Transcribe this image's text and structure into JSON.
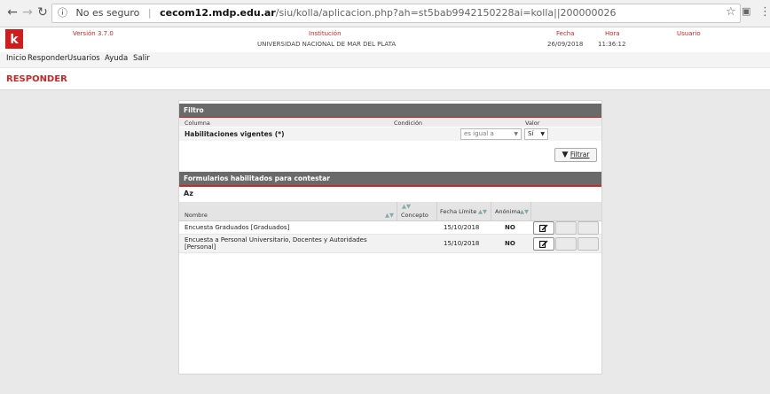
{
  "browser": {
    "security": "No es seguro",
    "host": "cecom12.mdp.edu.ar",
    "path": "/siu/kolla/aplicacion.php?ah=st5bab9942150228ai=kolla||200000026"
  },
  "header": {
    "version": "Versión 3.7.0",
    "institucion_label": "Institución",
    "institucion": "UNIVERSIDAD NACIONAL DE MAR DEL PLATA",
    "fecha_label": "Fecha",
    "fecha": "26/09/2018",
    "hora_label": "Hora",
    "hora": "11:36:12",
    "usuario_label": "Usuario"
  },
  "menu": [
    "Inicio",
    "Responder",
    "Usuarios",
    "Ayuda",
    "Salir"
  ],
  "page_title": "RESPONDER",
  "filter": {
    "title": "Filtro",
    "col_columna": "Columna",
    "col_condicion": "Condición",
    "col_valor": "Valor",
    "row_label": "Habilitaciones vigentes (*)",
    "condition": "es igual a",
    "value": "Sí",
    "button": "Filtrar"
  },
  "forms": {
    "title": "Formularios habilitados para contestar",
    "sort_icon": "Az",
    "columns": [
      "Nombre",
      "Concepto",
      "Fecha Límite",
      "Anónima"
    ],
    "rows": [
      {
        "nombre": "Encuesta Graduados [Graduados]",
        "concepto": "",
        "fecha": "15/10/2018",
        "anonima": "NO"
      },
      {
        "nombre": "Encuesta a Personal Universitario, Docentes y Autoridades",
        "nombre2": "[Personal]",
        "concepto": "",
        "fecha": "15/10/2018",
        "anonima": "NO"
      }
    ]
  }
}
